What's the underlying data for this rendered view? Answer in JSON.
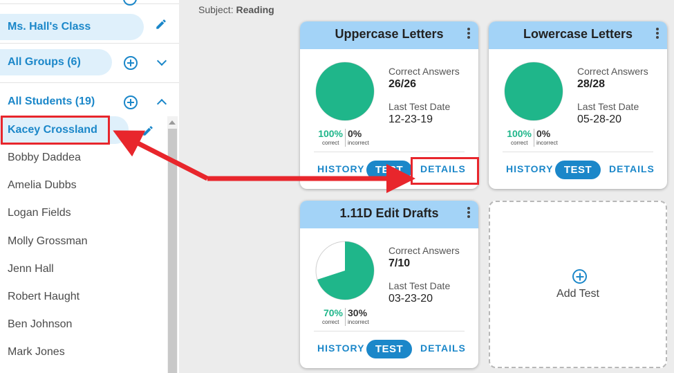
{
  "sidebar": {
    "class_label": "Ms. Hall's Class",
    "groups_label": "All Groups (6)",
    "students_label": "All Students (19)",
    "students": [
      "Kacey Crossland",
      "Bobby Daddea",
      "Amelia Dubbs",
      "Logan Fields",
      "Molly Grossman",
      "Jenn Hall",
      "Robert Haught",
      "Ben Johnson",
      "Mark Jones"
    ]
  },
  "main": {
    "subject_prefix": "Subject: ",
    "subject": "Reading",
    "cards": [
      {
        "title": "Uppercase Letters",
        "correct_label": "Correct Answers",
        "correct_value": "26/26",
        "date_label": "Last Test Date",
        "date_value": "12-23-19",
        "pct_correct": "100%",
        "pct_incorrect": "0%",
        "correct_sub": "correct",
        "incorrect_sub": "incorrect",
        "history_label": "HISTORY",
        "test_label": "TEST",
        "details_label": "DETAILS",
        "fraction_correct": 1.0
      },
      {
        "title": "Lowercase Letters",
        "correct_label": "Correct Answers",
        "correct_value": "28/28",
        "date_label": "Last Test Date",
        "date_value": "05-28-20",
        "pct_correct": "100%",
        "pct_incorrect": "0%",
        "correct_sub": "correct",
        "incorrect_sub": "incorrect",
        "history_label": "HISTORY",
        "test_label": "TEST",
        "details_label": "DETAILS",
        "fraction_correct": 1.0
      },
      {
        "title": "1.11D Edit Drafts",
        "correct_label": "Correct Answers",
        "correct_value": "7/10",
        "date_label": "Last Test Date",
        "date_value": "03-23-20",
        "pct_correct": "70%",
        "pct_incorrect": "30%",
        "correct_sub": "correct",
        "incorrect_sub": "incorrect",
        "history_label": "HISTORY",
        "test_label": "TEST",
        "details_label": "DETAILS",
        "fraction_correct": 0.7
      }
    ],
    "add_test_label": "Add Test"
  },
  "colors": {
    "accent": "#1b87c9",
    "correct_green": "#1fb68a",
    "card_header": "#a3d3f7",
    "highlight_red": "#e8262c"
  },
  "icons": [
    "plus-circle-icon",
    "chevron-down-icon",
    "chevron-up-icon",
    "pencil-icon",
    "kebab-menu-icon",
    "add-test-plus-icon"
  ]
}
